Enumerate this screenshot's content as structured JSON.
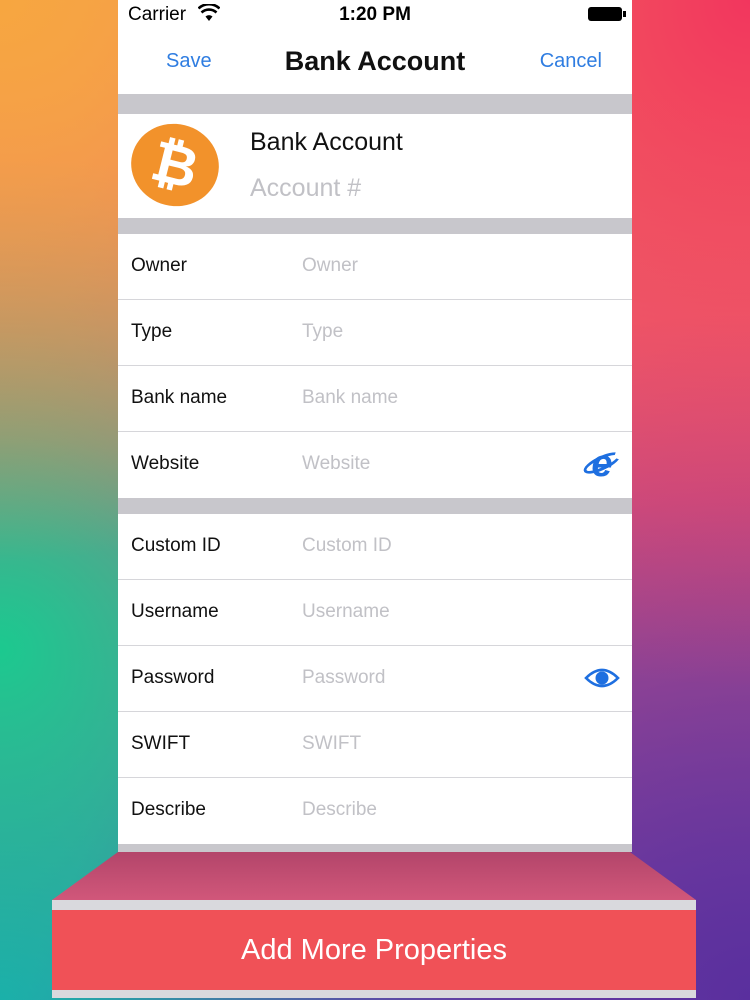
{
  "status_bar": {
    "carrier": "Carrier",
    "time": "1:20 PM"
  },
  "nav": {
    "save_label": "Save",
    "title": "Bank Account",
    "cancel_label": "Cancel"
  },
  "header": {
    "logo_glyph": "₿",
    "title": "Bank Account",
    "subtitle_placeholder": "Account #"
  },
  "section1": [
    {
      "label": "Owner",
      "placeholder": "Owner"
    },
    {
      "label": "Type",
      "placeholder": "Type"
    },
    {
      "label": "Bank name",
      "placeholder": "Bank name"
    },
    {
      "label": "Website",
      "placeholder": "Website",
      "icon": "internet-explorer-icon"
    }
  ],
  "section2": [
    {
      "label": "Custom ID",
      "placeholder": "Custom ID"
    },
    {
      "label": "Username",
      "placeholder": "Username"
    },
    {
      "label": "Password",
      "placeholder": "Password",
      "icon": "eye-icon"
    },
    {
      "label": "SWIFT",
      "placeholder": "SWIFT"
    },
    {
      "label": "Describe",
      "placeholder": "Describe"
    }
  ],
  "footer": {
    "add_label": "Add More Properties"
  },
  "colors": {
    "accent": "#2f7de1",
    "bitcoin": "#f2922b",
    "footer": "#f05157",
    "placeholder": "#c1c1c6"
  }
}
